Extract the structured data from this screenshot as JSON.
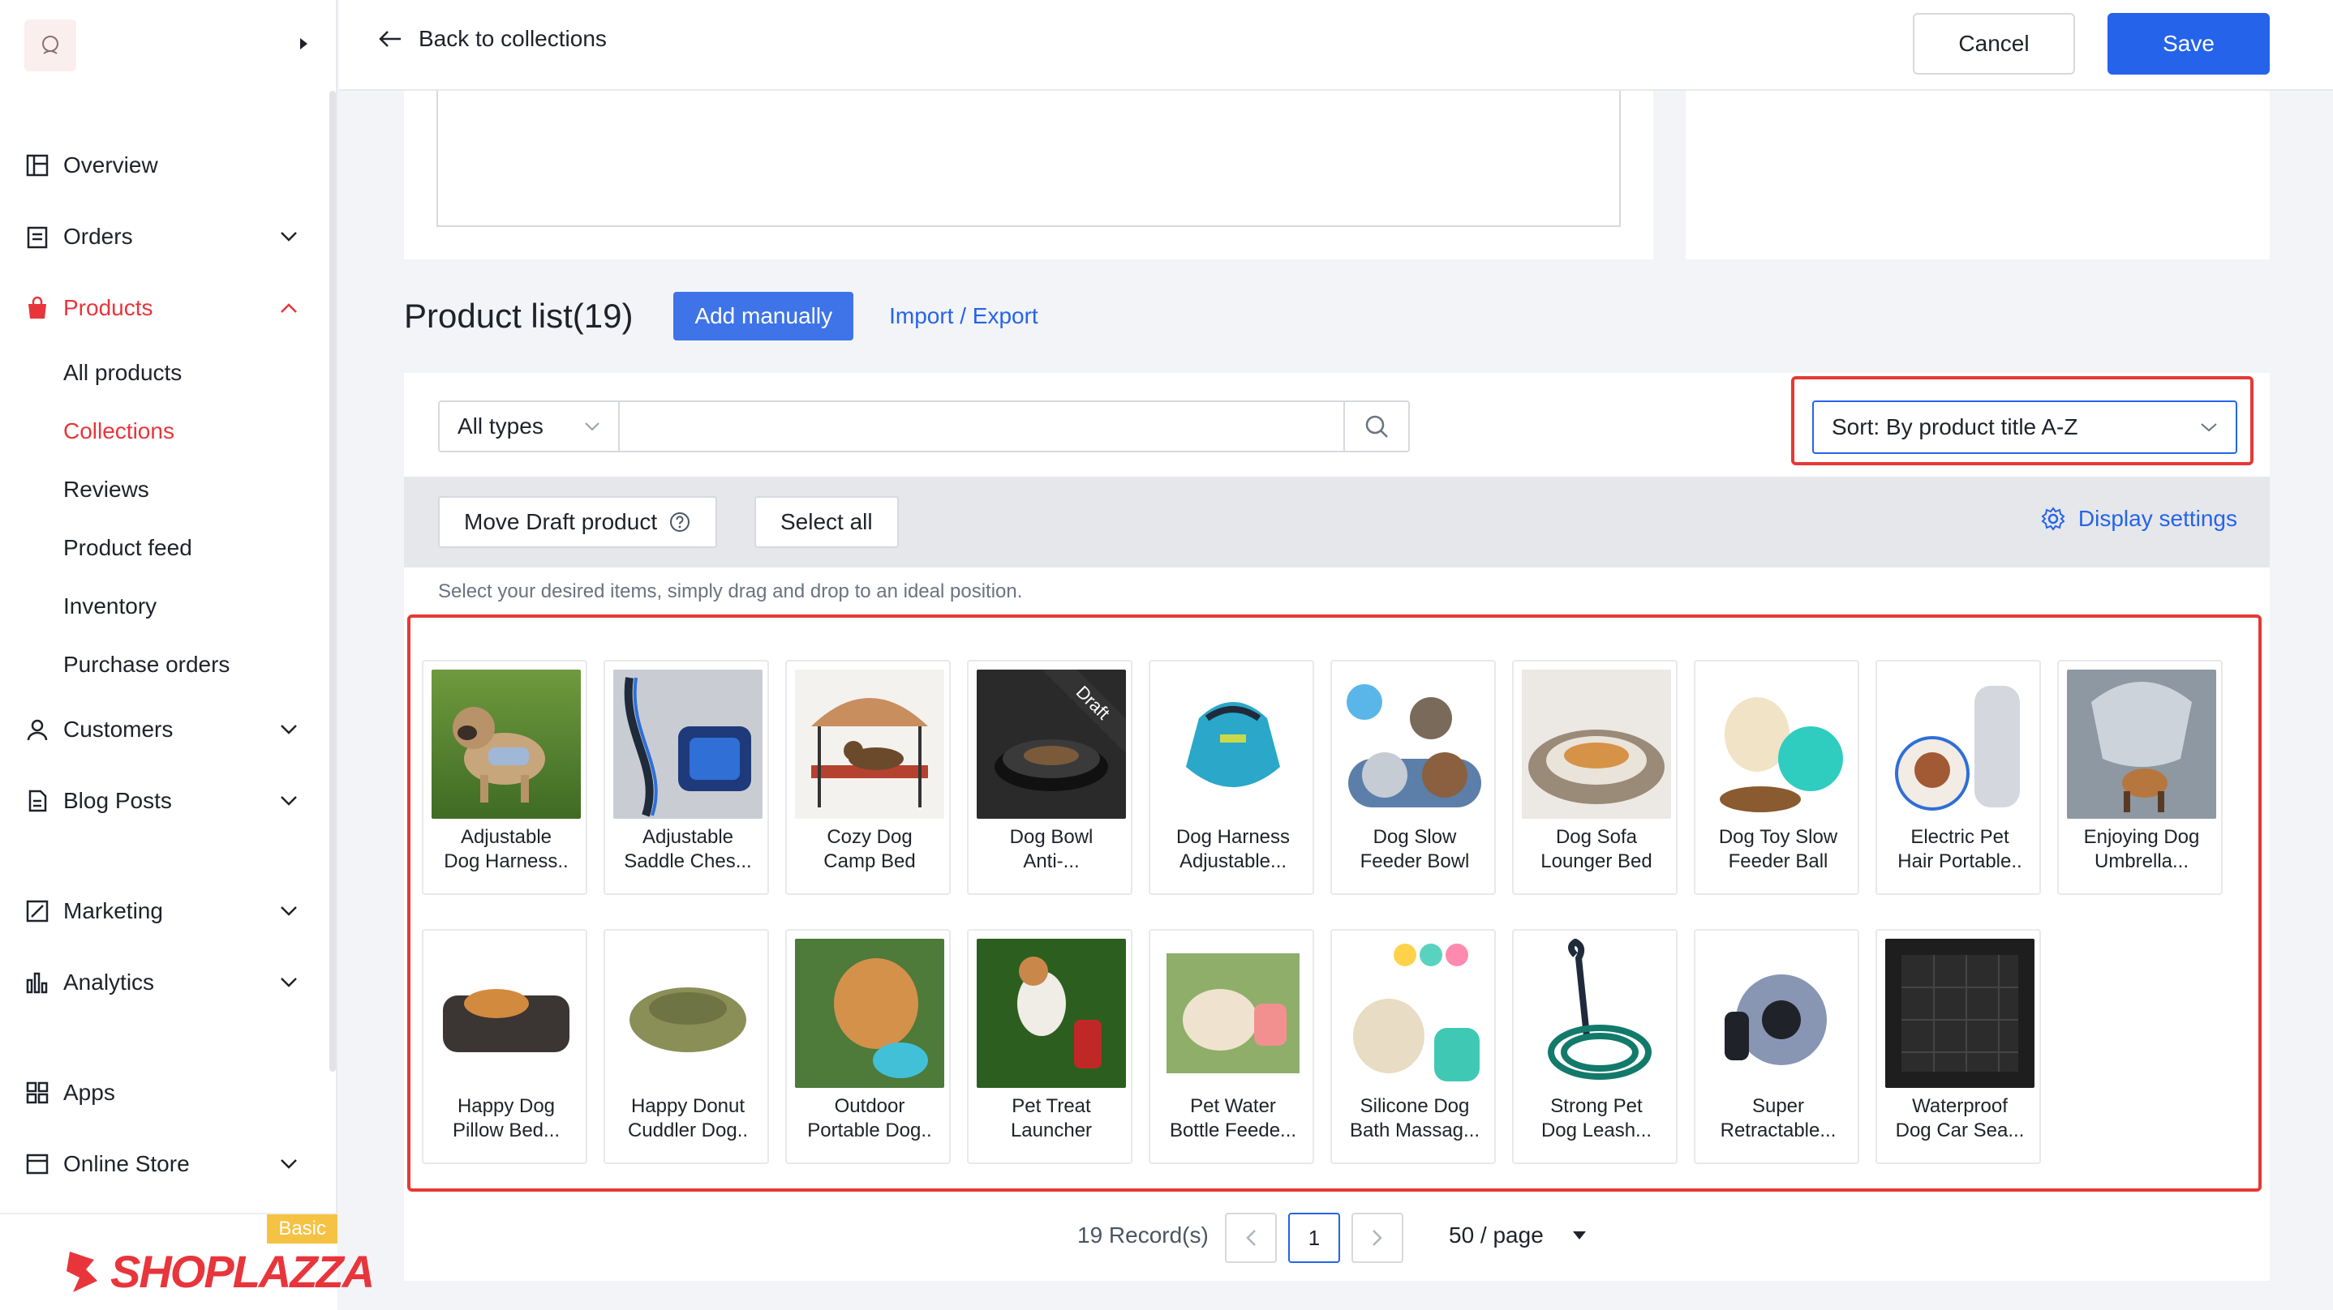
{
  "header": {
    "back_label": "Back to collections",
    "cancel_label": "Cancel",
    "save_label": "Save"
  },
  "sidebar": {
    "nav": [
      {
        "label": "Overview",
        "icon": "dashboard-icon"
      },
      {
        "label": "Orders",
        "icon": "clipboard-icon"
      },
      {
        "label": "Products",
        "icon": "shopping-bag-icon"
      },
      {
        "label": "Customers",
        "icon": "user-icon"
      },
      {
        "label": "Blog Posts",
        "icon": "document-icon"
      },
      {
        "label": "Marketing",
        "icon": "megaphone-icon"
      },
      {
        "label": "Analytics",
        "icon": "bar-chart-icon"
      },
      {
        "label": "Apps",
        "icon": "apps-grid-icon"
      },
      {
        "label": "Online Store",
        "icon": "store-icon"
      }
    ],
    "products_sub": [
      "All products",
      "Collections",
      "Reviews",
      "Product feed",
      "Inventory",
      "Purchase orders"
    ],
    "brand": "SHOPLAZZA",
    "plan_badge": "Basic",
    "accent_color": "#e8353c"
  },
  "product_list": {
    "title": "Product list(19)",
    "add_manually": "Add manually",
    "import_export": "Import / Export",
    "filter_type": "All types",
    "search_placeholder": "",
    "sort_label": "Sort: By product title A-Z",
    "move_draft": "Move Draft product",
    "select_all": "Select all",
    "display_settings": "Display settings",
    "hint": "Select your desired items, simply drag and drop to an ideal position.",
    "draft_label": "Draft",
    "products": [
      {
        "line1": "Adjustable",
        "line2": "Dog Harness..",
        "thumb": "pug-harness"
      },
      {
        "line1": "Adjustable",
        "line2": "Saddle Ches...",
        "thumb": "blue-leash"
      },
      {
        "line1": "Cozy Dog",
        "line2": "Camp Bed",
        "thumb": "camp-bed"
      },
      {
        "line1": "Dog Bowl",
        "line2": "Anti-...",
        "thumb": "dog-bowl",
        "draft": true
      },
      {
        "line1": "Dog Harness",
        "line2": "Adjustable...",
        "thumb": "teal-harness"
      },
      {
        "line1": "Dog Slow",
        "line2": "Feeder Bowl",
        "thumb": "feeder-bowl"
      },
      {
        "line1": "Dog Sofa",
        "line2": "Lounger Bed",
        "thumb": "sofa-bed"
      },
      {
        "line1": "Dog Toy Slow",
        "line2": "Feeder Ball",
        "thumb": "toy-ball"
      },
      {
        "line1": "Electric Pet",
        "line2": "Hair Portable..",
        "thumb": "hair-vacuum"
      },
      {
        "line1": "Enjoying Dog",
        "line2": "Umbrella...",
        "thumb": "umbrella"
      },
      {
        "line1": "Happy Dog",
        "line2": "Pillow Bed...",
        "thumb": "pillow-bed"
      },
      {
        "line1": "Happy Donut",
        "line2": "Cuddler Dog..",
        "thumb": "donut-bed"
      },
      {
        "line1": "Outdoor",
        "line2": "Portable Dog..",
        "thumb": "portable-bottle"
      },
      {
        "line1": "Pet Treat",
        "line2": "Launcher",
        "thumb": "treat-launcher"
      },
      {
        "line1": "Pet Water",
        "line2": "Bottle Feede...",
        "thumb": "water-bottle"
      },
      {
        "line1": "Silicone Dog",
        "line2": "Bath Massag...",
        "thumb": "bath-brush"
      },
      {
        "line1": "Strong Pet",
        "line2": "Dog Leash...",
        "thumb": "rope-leash"
      },
      {
        "line1": "Super",
        "line2": "Retractable...",
        "thumb": "retractable-leash"
      },
      {
        "line1": "Waterproof",
        "line2": "Dog Car Sea...",
        "thumb": "car-seat"
      }
    ],
    "records": "19 Record(s)",
    "current_page": "1",
    "per_page": "50 / page"
  }
}
